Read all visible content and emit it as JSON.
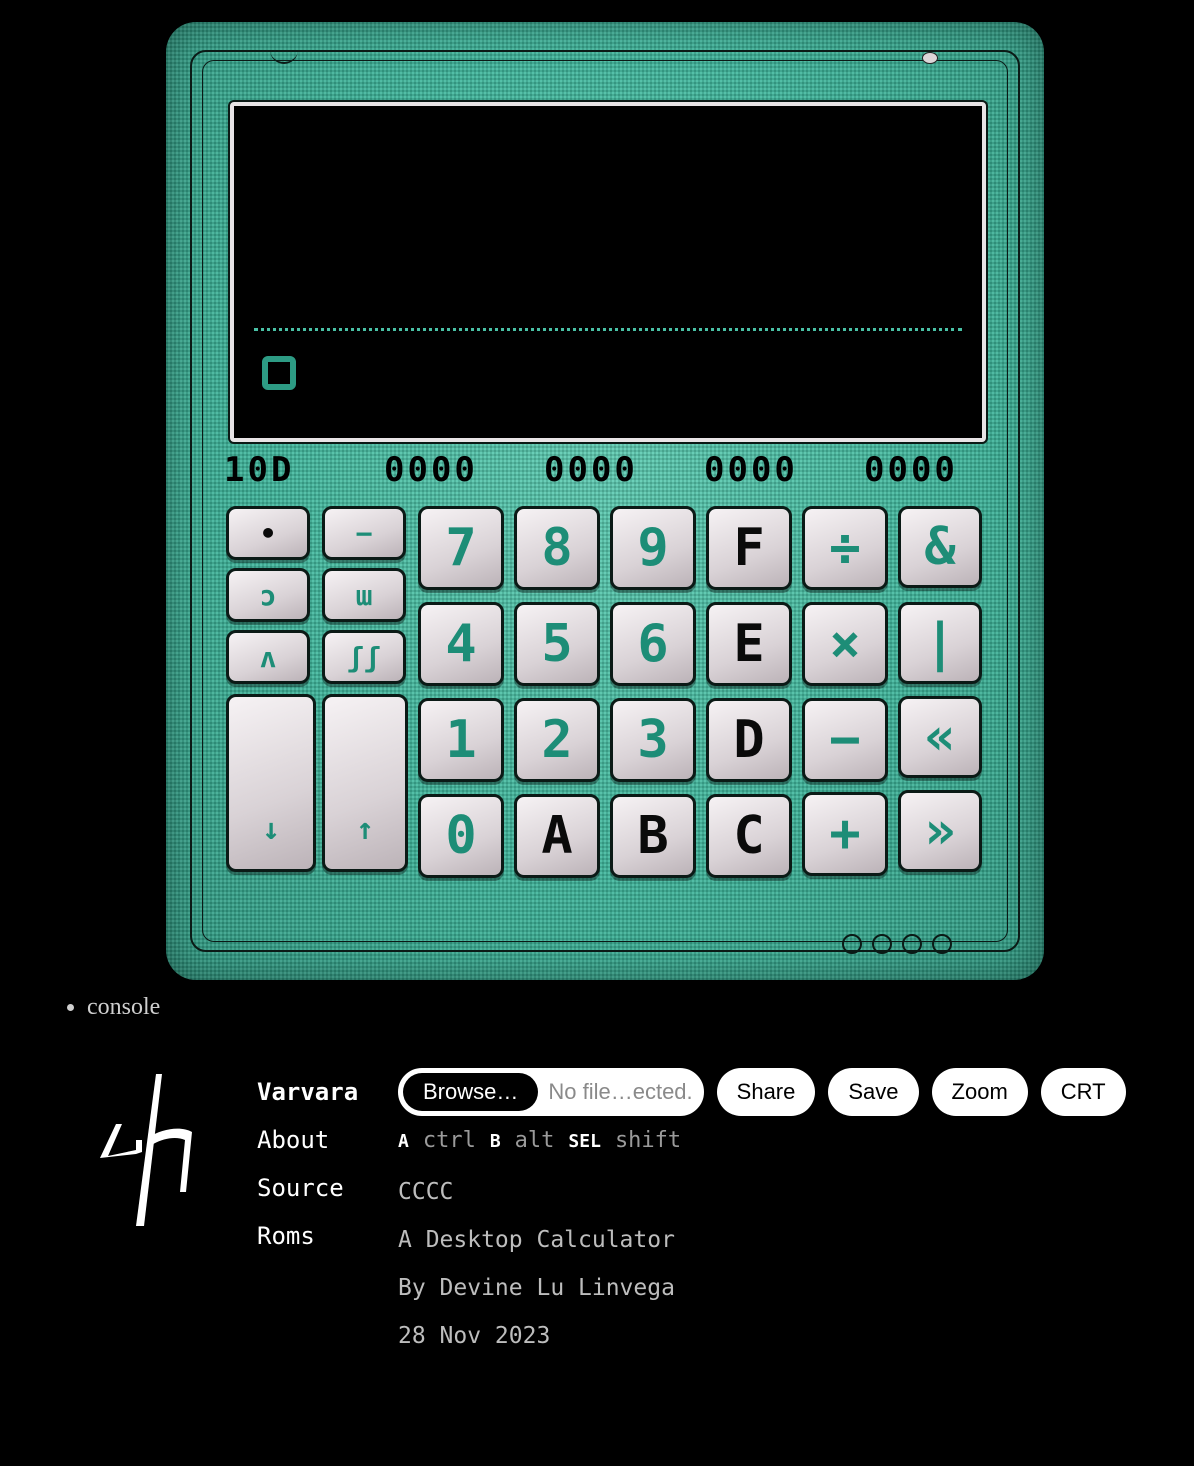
{
  "device": {
    "status": {
      "base": "10D",
      "groups": [
        "0000",
        "0000",
        "0000",
        "0000"
      ]
    },
    "screen": {
      "value": ""
    },
    "keys": {
      "col1": [
        "•",
        "ɔ",
        "ʌ",
        "↓"
      ],
      "col2": [
        "−",
        "ɯ",
        "ʃʃ",
        "↑"
      ],
      "grid": [
        [
          "7",
          "8",
          "9",
          "F",
          "÷",
          "&"
        ],
        [
          "4",
          "5",
          "6",
          "E",
          "×",
          "|"
        ],
        [
          "1",
          "2",
          "3",
          "D",
          "−",
          "«"
        ],
        [
          "0",
          "A",
          "B",
          "C",
          "+",
          "»"
        ]
      ]
    }
  },
  "console": {
    "label": "console"
  },
  "nav": {
    "items": [
      "Varvara",
      "About",
      "Source",
      "Roms"
    ]
  },
  "controls": {
    "browse_label": "Browse…",
    "file_status": "No file…ected.",
    "share_label": "Share",
    "save_label": "Save",
    "zoom_label": "Zoom",
    "crt_label": "CRT"
  },
  "keymap": [
    {
      "key": "A",
      "value": "ctrl"
    },
    {
      "key": "B",
      "value": "alt"
    },
    {
      "key": "SEL",
      "value": "shift"
    }
  ],
  "info": {
    "name": "CCCC",
    "description": "A Desktop Calculator",
    "author": "By Devine Lu Linvega",
    "date": "28 Nov 2023"
  }
}
